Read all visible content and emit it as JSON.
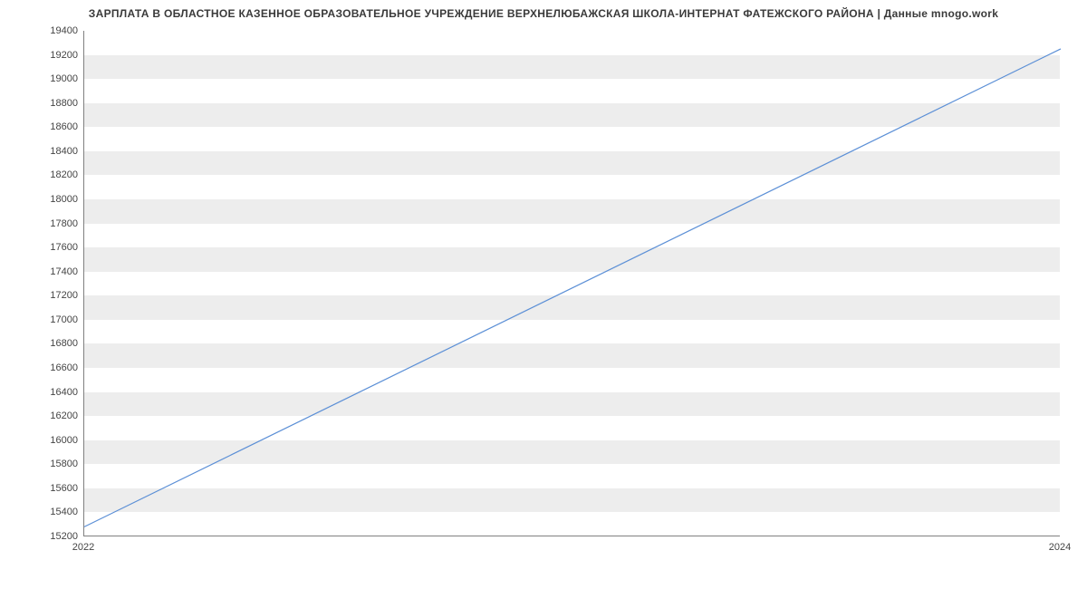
{
  "chart_data": {
    "type": "line",
    "title": "ЗАРПЛАТА В ОБЛАСТНОЕ КАЗЕННОЕ ОБРАЗОВАТЕЛЬНОЕ УЧРЕЖДЕНИЕ ВЕРХНЕЛЮБАЖСКАЯ ШКОЛА-ИНТЕРНАТ ФАТЕЖСКОГО РАЙОНА | Данные mnogo.work",
    "x": [
      2022,
      2024
    ],
    "values": [
      15280,
      19250
    ],
    "xlabel": "",
    "ylabel": "",
    "xlim": [
      2022,
      2024
    ],
    "ylim": [
      15200,
      19400
    ],
    "x_ticks": [
      2022,
      2024
    ],
    "y_ticks": [
      15200,
      15400,
      15600,
      15800,
      16000,
      16200,
      16400,
      16600,
      16800,
      17000,
      17200,
      17400,
      17600,
      17800,
      18000,
      18200,
      18400,
      18600,
      18800,
      19000,
      19200,
      19400
    ],
    "line_color": "#5b8fd6"
  }
}
